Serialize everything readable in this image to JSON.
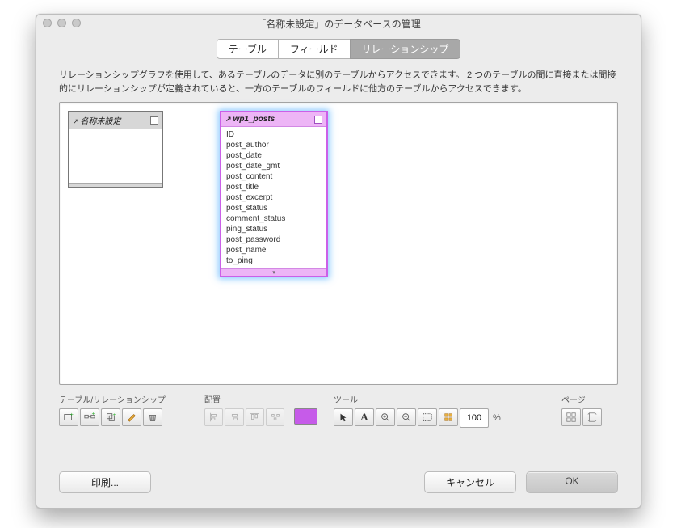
{
  "window": {
    "title": "「名称未設定」のデータベースの管理"
  },
  "tabs": {
    "items": [
      {
        "label": "テーブル"
      },
      {
        "label": "フィールド"
      },
      {
        "label": "リレーションシップ"
      }
    ]
  },
  "description": "リレーションシップグラフを使用して、あるテーブルのデータに別のテーブルからアクセスできます。 2 つのテーブルの間に直接または間接的にリレーションシップが定義されていると、一方のテーブルのフィールドに他方のテーブルからアクセスできます。",
  "graph": {
    "boxes": [
      {
        "name": "名称未設定",
        "fields": []
      },
      {
        "name": "wp1_posts",
        "fields": [
          "ID",
          "post_author",
          "post_date",
          "post_date_gmt",
          "post_content",
          "post_title",
          "post_excerpt",
          "post_status",
          "comment_status",
          "ping_status",
          "post_password",
          "post_name",
          "to_ping"
        ]
      }
    ]
  },
  "toolbar": {
    "groups": {
      "tables": "テーブル/リレーションシップ",
      "arrange": "配置",
      "tools": "ツール",
      "pages": "ページ"
    },
    "zoom": "100",
    "color": "#c65be9"
  },
  "buttons": {
    "print": "印刷...",
    "cancel": "キャンセル",
    "ok": "OK"
  }
}
